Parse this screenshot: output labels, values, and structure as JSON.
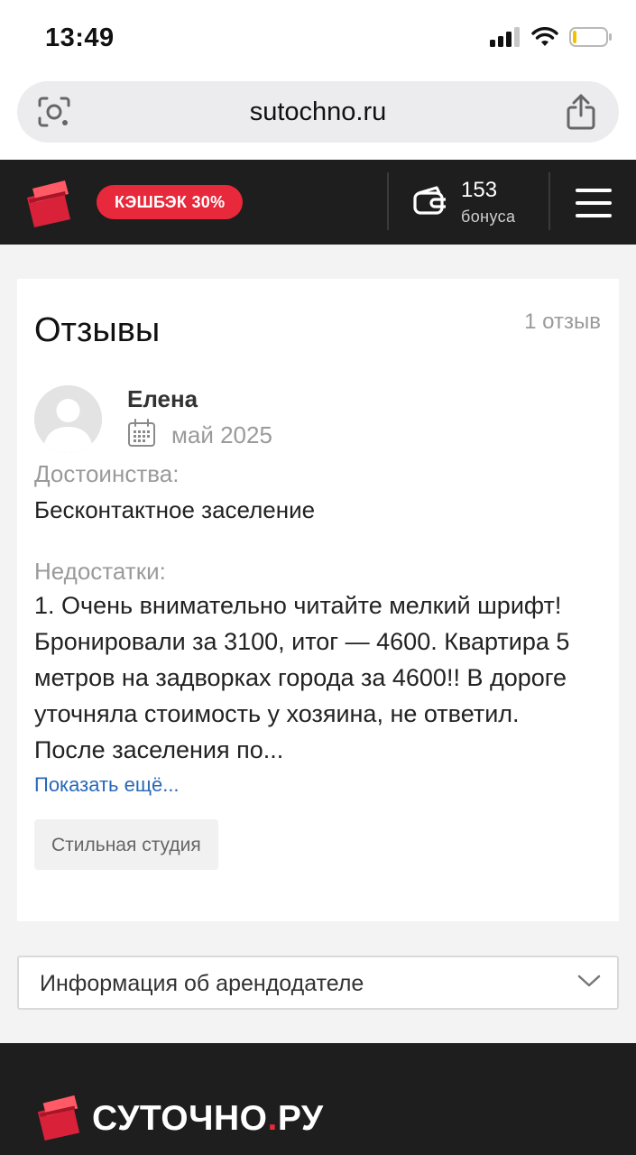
{
  "status_bar": {
    "time": "13:49"
  },
  "browser": {
    "url": "sutochno.ru"
  },
  "header": {
    "cashback_label": "КЭШБЭК 30%",
    "bonus_count": "153",
    "bonus_label": "бонуса",
    "brand_color": "#e8283b"
  },
  "reviews": {
    "title": "Отзывы",
    "count_label": "1 отзыв",
    "items": [
      {
        "author": "Елена",
        "date": "май 2025",
        "pros_label": "Достоинства:",
        "pros_text": "Бесконтактное заселение",
        "cons_label": "Недостатки:",
        "cons_text": "1. Очень внимательно читайте мелкий шрифт! Бронировали за 3100, итог — 4600. Квартира 5 метров на задворках города за 4600!! В дороге уточняла стоимость у хозяина, не ответил. После заселения по...",
        "show_more": "Показать ещё...",
        "tag": "Стильная студия"
      }
    ]
  },
  "landlord_accordion": {
    "label": "Информация об арендодателе"
  },
  "footer": {
    "brand_main": "СУТОЧНО",
    "brand_dot": ".",
    "brand_tail": "РУ"
  }
}
